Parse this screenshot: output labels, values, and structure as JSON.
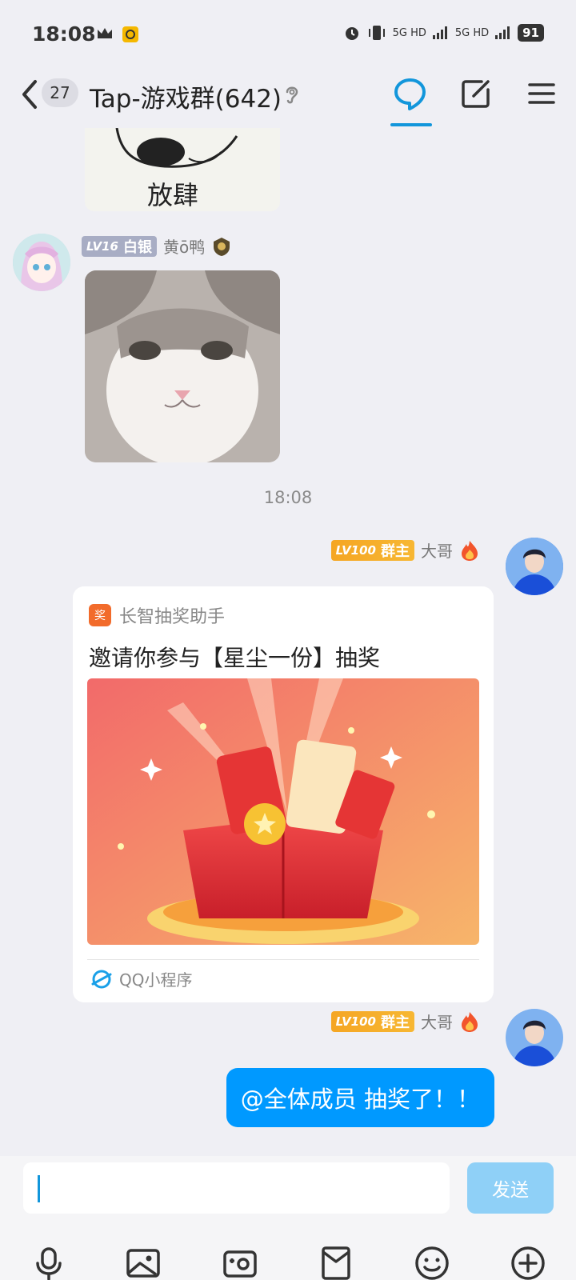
{
  "status_bar": {
    "time": "18:08",
    "network_1": "5G HD",
    "network_2": "5G HD",
    "battery": "91"
  },
  "header": {
    "unread_count": "27",
    "title": "Tap-游戏群(642)",
    "accent_color": "#1296db"
  },
  "messages": {
    "msg1": {
      "level": "LV16",
      "title_badge": "白银",
      "nickname": "黄ō鸭"
    },
    "timestamp": "18:08",
    "msg2": {
      "level": "LV100",
      "title_badge": "群主",
      "nickname": "大哥",
      "card": {
        "app_name": "长智抽奖助手",
        "app_icon_text": "奖",
        "title": "邀请你参与【星尘一份】抽奖",
        "footer": "QQ小程序"
      }
    },
    "msg3": {
      "level": "LV100",
      "title_badge": "群主",
      "nickname": "大哥",
      "text": "@全体成员 抽奖了！！"
    }
  },
  "input": {
    "value": "",
    "send_label": "发送"
  },
  "toolbar": [
    "mic-icon",
    "image-icon",
    "camera-icon",
    "red-packet-icon",
    "emoji-icon",
    "plus-icon"
  ]
}
